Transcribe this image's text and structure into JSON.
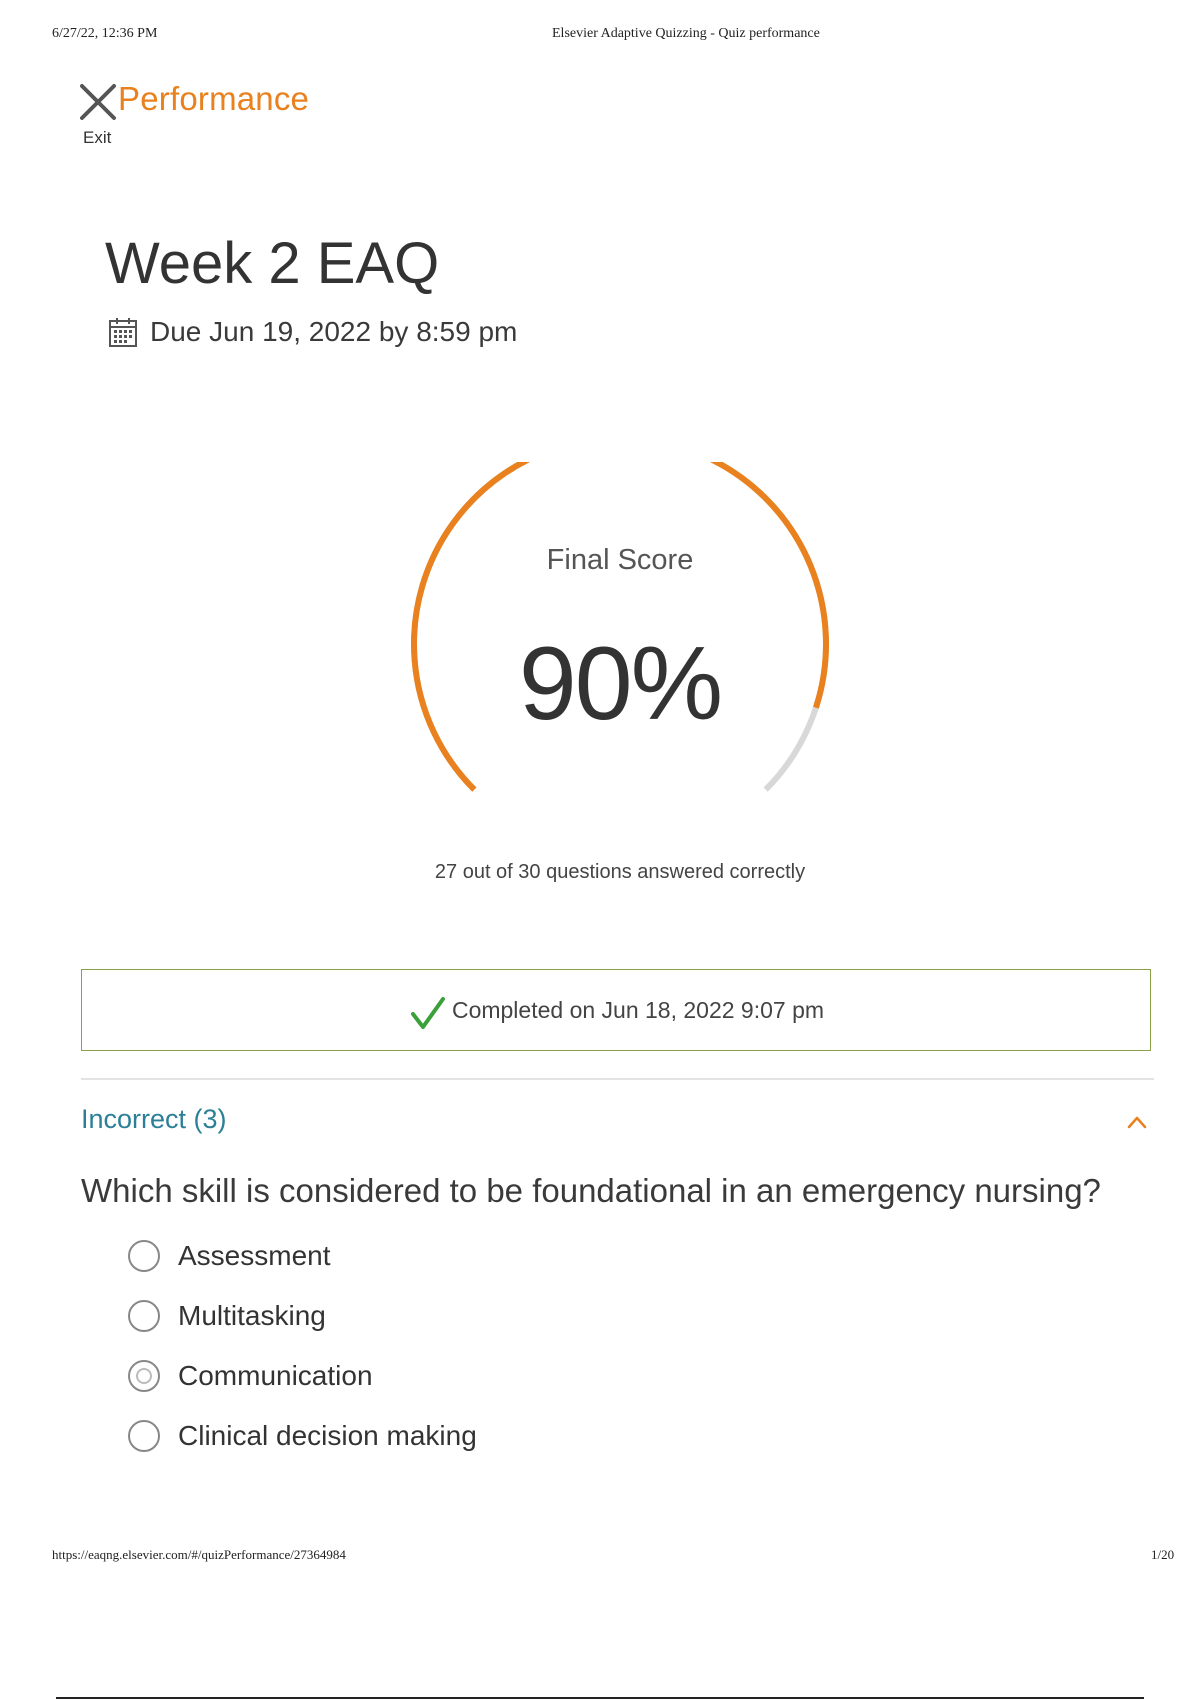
{
  "print_header": {
    "datetime": "6/27/22, 12:36 PM",
    "page_title": "Elsevier Adaptive Quizzing - Quiz performance"
  },
  "print_footer": {
    "url": "https://eaqng.elsevier.com/#/quizPerformance/27364984",
    "page_number": "1/20"
  },
  "header": {
    "title": "Performance",
    "exit_label": "Exit",
    "close_icon": "close-icon"
  },
  "quiz": {
    "title": "Week 2 EAQ",
    "due_text": "Due Jun 19, 2022 by 8:59 pm",
    "due_icon": "calendar-icon"
  },
  "score": {
    "label": "Final Score",
    "value_text": "90%",
    "fraction": 0.9,
    "correct_text": "27 out of 30 questions answered correctly",
    "colors": {
      "progress": "#e8811e",
      "track": "#d8d8d8"
    }
  },
  "completion": {
    "text": "Completed on Jun 18, 2022 9:07 pm",
    "icon": "check-icon",
    "colors": {
      "border": "#8aa04a",
      "check": "#3aa03a"
    }
  },
  "incorrect_section": {
    "label": "Incorrect (3)",
    "expanded": true,
    "toggle_icon": "chevron-up-icon",
    "color": "#2b7f96"
  },
  "question": {
    "text": "Which skill is considered to be foundational in an emergency nursing?",
    "options": [
      {
        "label": "Assessment",
        "selected": false
      },
      {
        "label": "Multitasking",
        "selected": false
      },
      {
        "label": "Communication",
        "selected": true
      },
      {
        "label": "Clinical decision making",
        "selected": false
      }
    ]
  }
}
